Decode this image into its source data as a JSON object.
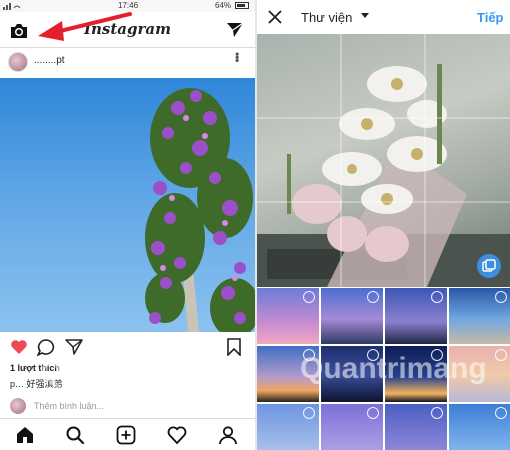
{
  "left_screen": {
    "status_bar": {
      "time": "17:46",
      "battery": "64%"
    },
    "header": {
      "logo": "Instagram"
    },
    "post": {
      "username": "........pt",
      "likes": "1 lượt thích",
      "caption": "p… 好强滇弟",
      "comment_placeholder": "Thêm bình luận..."
    }
  },
  "right_screen": {
    "header": {
      "title": "Thư viện",
      "next_label": "Tiếp"
    }
  },
  "watermark": "Quantrimang",
  "colors": {
    "accent": "#3897f0",
    "like": "#ed4956",
    "arrow": "#e5202e"
  }
}
